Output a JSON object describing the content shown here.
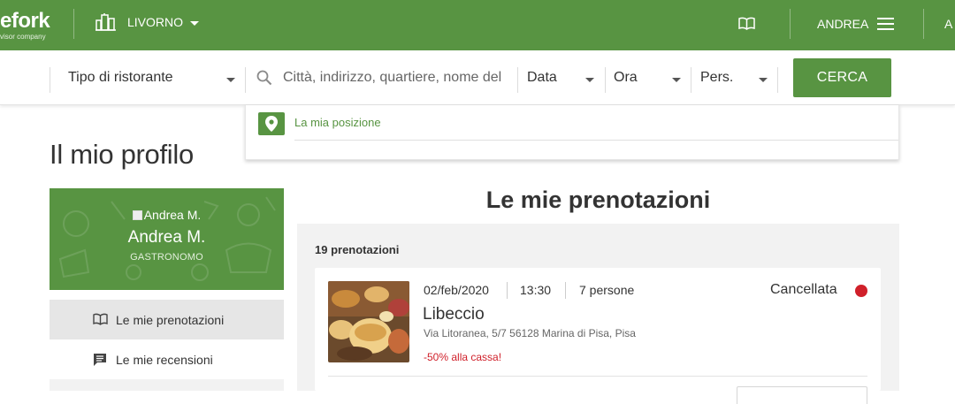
{
  "header": {
    "logo_text": "efork",
    "logo_sub": "visor company",
    "city": "LIVORNO",
    "user_name": "ANDREA",
    "extra_link": "A",
    "icons": [
      "city-icon",
      "book-icon",
      "hamburger-icon"
    ]
  },
  "search": {
    "restaurant_type": "Tipo di ristorante",
    "location_placeholder": "Città, indirizzo, quartiere, nome del ristorante",
    "date_label": "Data",
    "time_label": "Ora",
    "people_label": "Pers.",
    "submit_label": "CERCA"
  },
  "location_dropdown": {
    "my_position": "La mia posizione"
  },
  "page": {
    "title": "Il mio profilo"
  },
  "profile": {
    "avatar_alt": "Andrea M.",
    "name": "Andrea M.",
    "rank": "GASTRONOMO"
  },
  "sidebar": {
    "items": [
      {
        "label": "Le mie prenotazioni",
        "icon": "book-icon",
        "active": true
      },
      {
        "label": "Le mie recensioni",
        "icon": "review-icon",
        "active": false
      }
    ]
  },
  "reservations": {
    "title": "Le mie prenotazioni",
    "count_label": "19 prenotazioni",
    "items": [
      {
        "date": "02/feb/2020",
        "time": "13:30",
        "people": "7 persone",
        "status": "Cancellata",
        "restaurant": "Libeccio",
        "address": "Via Litoranea, 5/7 56128 Marina di Pisa, Pisa",
        "promo": "-50% alla cassa!"
      }
    ]
  },
  "colors": {
    "brand_green": "#589442",
    "status_cancelled": "#d0202a",
    "panel_gray": "#f2f2f2"
  }
}
